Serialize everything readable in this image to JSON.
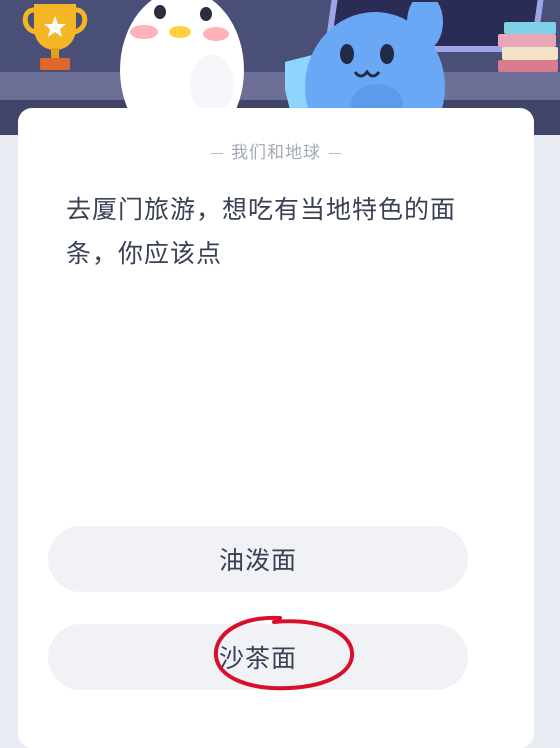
{
  "quiz": {
    "category": "我们和地球",
    "question": "去厦门旅游，想吃有当地特色的面条，你应该点",
    "options": [
      {
        "label": "油泼面"
      },
      {
        "label": "沙茶面"
      }
    ]
  },
  "icons": {
    "trophy": "trophy-icon",
    "books": "books-icon",
    "mascot_penguin": "penguin-mascot",
    "mascot_bunny": "bunny-mascot"
  },
  "colors": {
    "banner": "#4a4f78",
    "card": "#ffffff",
    "option_bg": "#f1f2f6",
    "text": "#3a4055",
    "annotation": "#d8102a"
  }
}
